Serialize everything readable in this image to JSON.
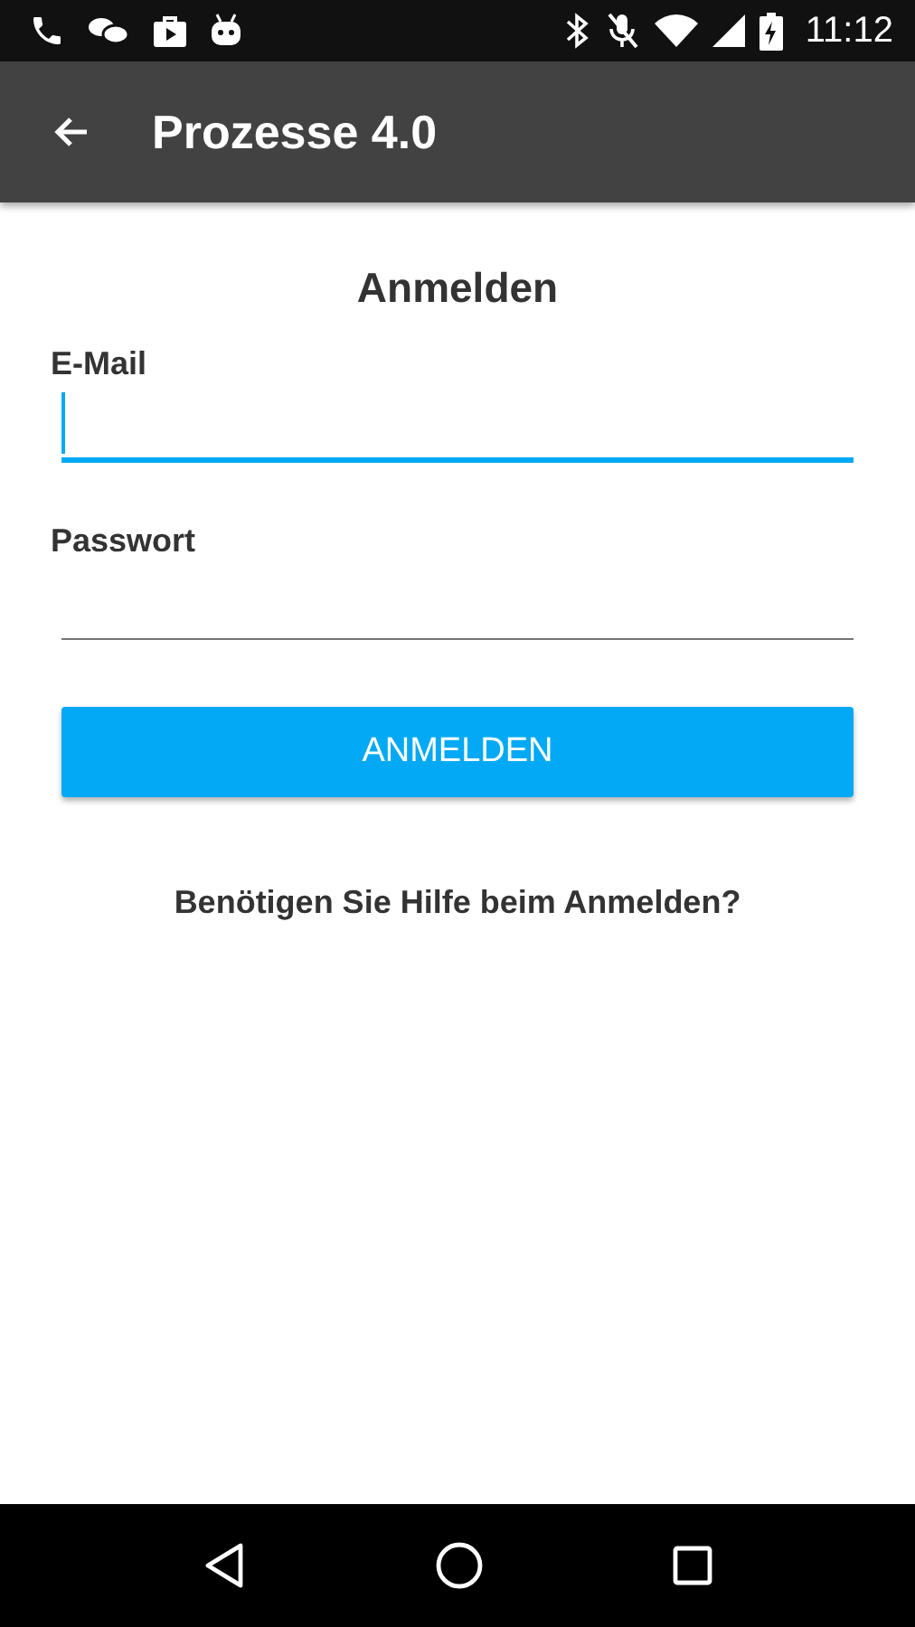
{
  "status_bar": {
    "time": "11:12"
  },
  "app_bar": {
    "title": "Prozesse 4.0"
  },
  "form": {
    "title": "Anmelden",
    "fields": [
      {
        "label": "E-Mail",
        "focused": true
      },
      {
        "label": "Passwort",
        "focused": false
      }
    ],
    "submit": "ANMELDEN",
    "help_link": "Benötigen Sie Hilfe beim Anmelden?"
  }
}
